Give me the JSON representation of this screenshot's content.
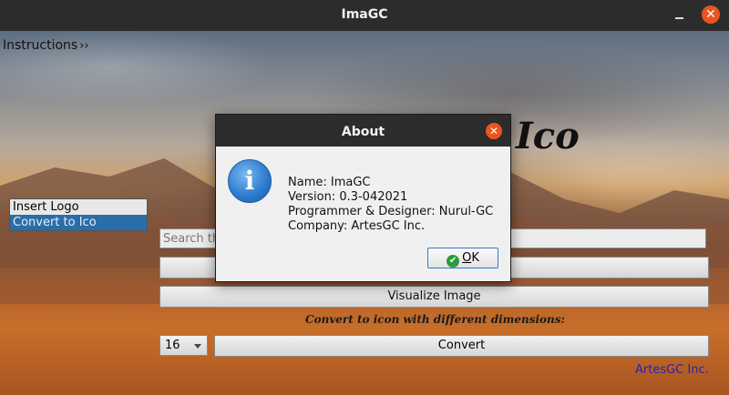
{
  "window": {
    "title": "ImaGC"
  },
  "menubar": {
    "instructions_label": "Instructions",
    "chevron": "››"
  },
  "menu_items": [
    {
      "label": "Insert Logo",
      "active": false
    },
    {
      "label": "Convert to Ico",
      "active": true
    }
  ],
  "background_heading": "Ico",
  "search": {
    "placeholder": "Search th"
  },
  "buttons": {
    "visualize": "Visualize Image",
    "convert": "Convert"
  },
  "caption": "Convert to icon with different dimensions:",
  "dimension_select": {
    "value": "16"
  },
  "company_label": "ArtesGC Inc.",
  "about_dialog": {
    "title": "About",
    "lines": [
      "Name: ImaGC",
      "Version: 0.3-042021",
      "Programmer & Designer: Nurul-GC",
      "Company: ArtesGC Inc."
    ],
    "ok_label_first": "O",
    "ok_label_rest": "K",
    "icon": "info-icon"
  },
  "colors": {
    "accent_close": "#e95420",
    "selection": "#2a6da7",
    "company": "#2b20b4"
  }
}
